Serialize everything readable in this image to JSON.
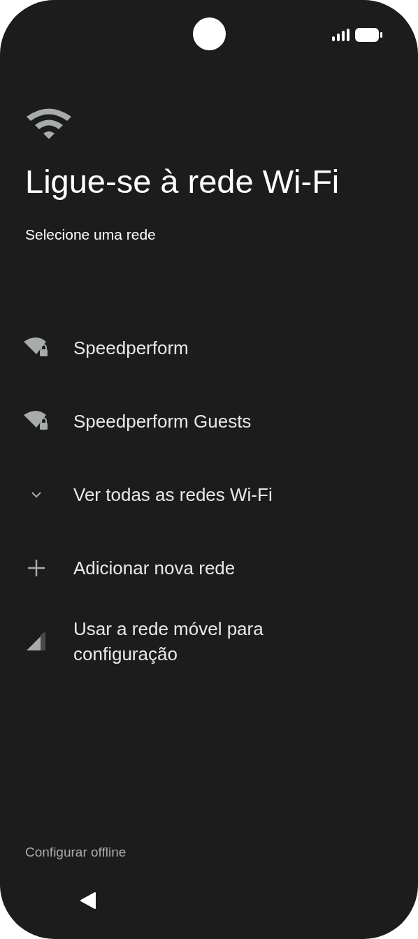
{
  "title": "Ligue-se à rede Wi-Fi",
  "subtitle": "Selecione uma rede",
  "items": [
    {
      "kind": "wifi_locked",
      "label": "Speedperform"
    },
    {
      "kind": "wifi_locked",
      "label": "Speedperform Guests"
    },
    {
      "kind": "expand",
      "label": "Ver todas as redes Wi-Fi"
    },
    {
      "kind": "add",
      "label": "Adicionar nova rede"
    },
    {
      "kind": "mobile",
      "label": "Usar a rede móvel para configuração"
    }
  ],
  "footer_link": "Configurar offline"
}
